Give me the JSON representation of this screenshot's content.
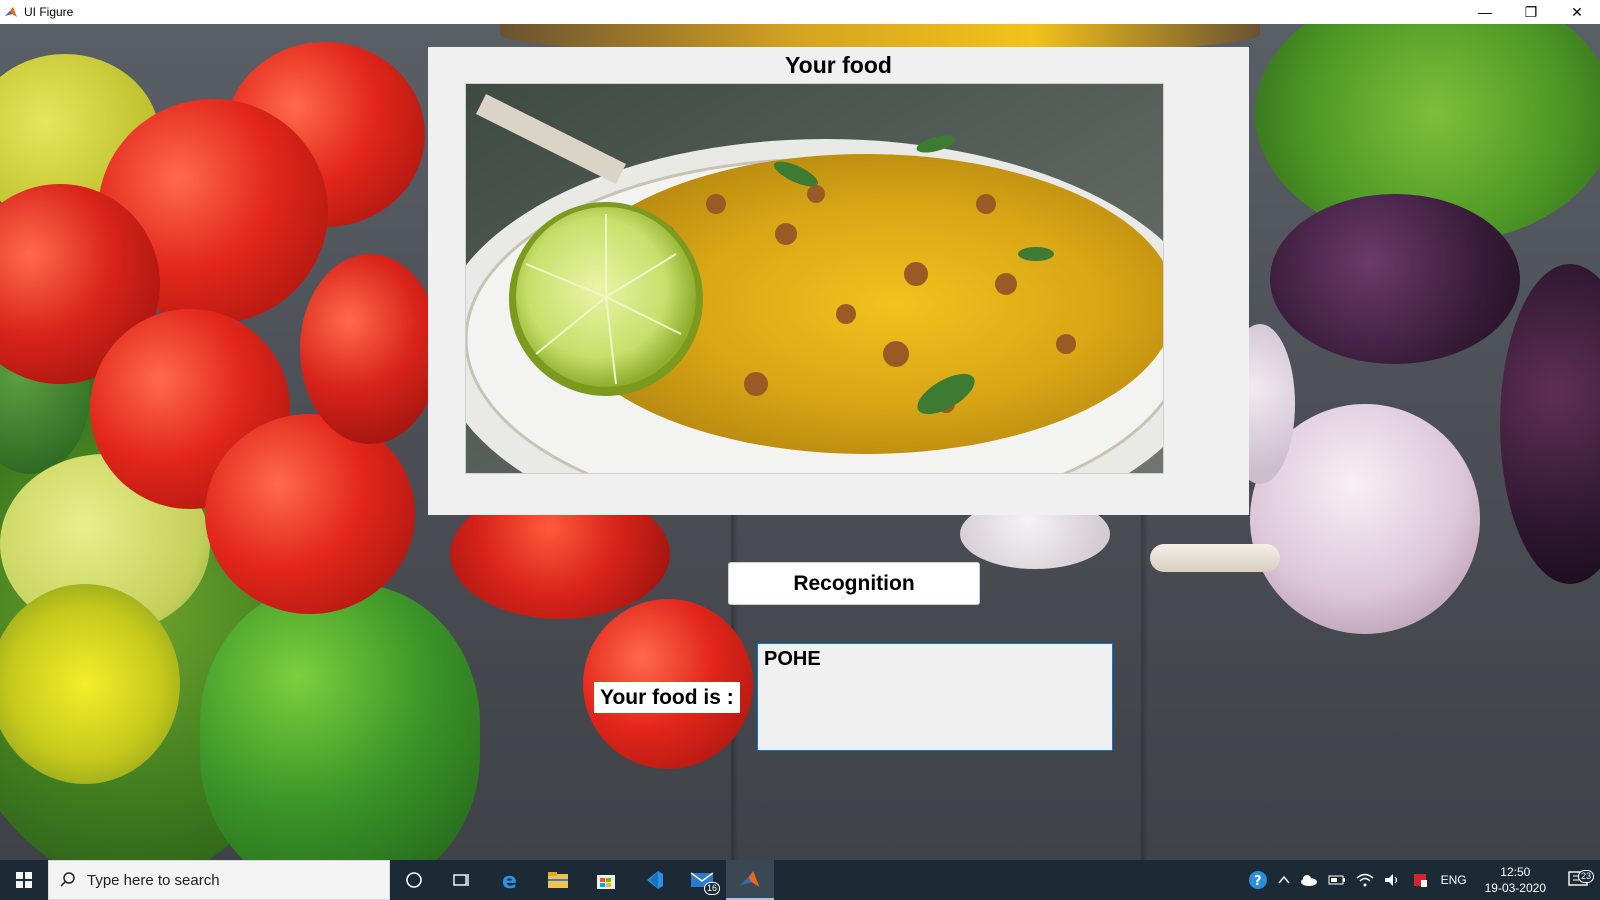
{
  "window": {
    "title": "UI Figure",
    "minimize_glyph": "—",
    "restore_glyph": "❐",
    "close_glyph": "✕"
  },
  "panel": {
    "title": "Your food",
    "image_subject": "plate of poha with lime"
  },
  "recognition_button": {
    "label": "Recognition"
  },
  "result": {
    "label": "Your food is :",
    "value": "POHE"
  },
  "taskbar": {
    "search_placeholder": "Type here to search",
    "mail_badge": "16",
    "language": "ENG",
    "time": "12:50",
    "date": "19-03-2020",
    "notifications_badge": "23",
    "icons": [
      "windows-start-icon",
      "cortana-icon",
      "task-view-icon",
      "edge-icon",
      "file-explorer-icon",
      "store-icon",
      "vscode-icon",
      "mail-icon",
      "matlab-icon"
    ]
  },
  "colors": {
    "taskbar": "#1c2a35",
    "panel": "#f0f0f0",
    "result_border": "#0078d7"
  }
}
